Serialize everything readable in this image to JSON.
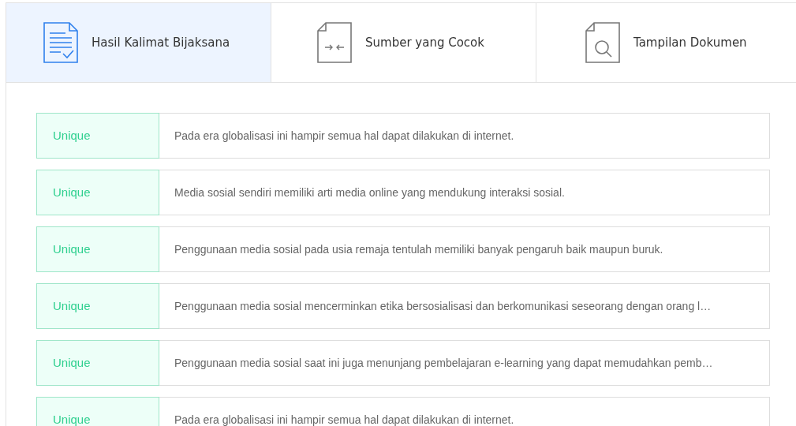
{
  "tabs": [
    {
      "label": "Hasil Kalimat Bijaksana",
      "kind": "result",
      "selected": true
    },
    {
      "label": "Sumber yang Cocok",
      "kind": "sources",
      "selected": false
    },
    {
      "label": "Tampilan Dokumen",
      "kind": "document",
      "selected": false
    }
  ],
  "results": [
    {
      "status": "Unique",
      "sentence": "Pada era globalisasi ini hampir semua hal dapat dilakukan di internet."
    },
    {
      "status": "Unique",
      "sentence": "Media sosial sendiri memiliki arti media online yang mendukung interaksi sosial."
    },
    {
      "status": "Unique",
      "sentence": "Penggunaan media sosial pada usia remaja tentulah memiliki banyak pengaruh baik maupun buruk."
    },
    {
      "status": "Unique",
      "sentence": "Penggunaan media sosial mencerminkan etika bersosialisasi dan berkomunikasi seseorang dengan orang l…"
    },
    {
      "status": "Unique",
      "sentence": "Penggunaan media sosial saat ini juga menunjang pembelajaran e-learning yang dapat memudahkan pemb…"
    },
    {
      "status": "Unique",
      "sentence": "Pada era globalisasi ini hampir semua hal dapat dilakukan di internet."
    }
  ]
}
